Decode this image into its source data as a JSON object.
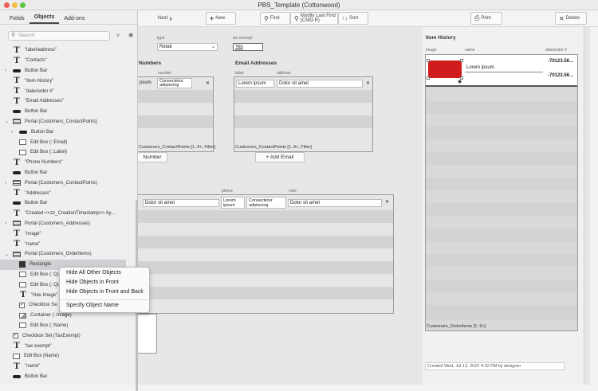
{
  "window": {
    "title": "PBS_Template (Cottonwood)"
  },
  "toolbar": {
    "next": "Next",
    "new": "New",
    "find": "Find",
    "modify_last_find": "Modify Last Find",
    "modify_shortcut": "(CMD-R)",
    "sort": "Sort",
    "print": "Print",
    "delete": "Delete"
  },
  "sidebar": {
    "tabs": [
      "Fields",
      "Objects",
      "Add-ons"
    ],
    "search_placeholder": "Search",
    "objects": [
      {
        "label": "\"label/address\"",
        "icon": "text",
        "indent": 0
      },
      {
        "label": "\"Contacts\"",
        "icon": "text",
        "indent": 0
      },
      {
        "label": "Button Bar",
        "icon": "buttonbar",
        "indent": 0,
        "arrow": true
      },
      {
        "label": "\"Item History\"",
        "icon": "text",
        "indent": 0
      },
      {
        "label": "\"date/order #\"",
        "icon": "text",
        "indent": 0
      },
      {
        "label": "\"Email Addresses\"",
        "icon": "text",
        "indent": 0
      },
      {
        "label": "Button Bar",
        "icon": "buttonbar",
        "indent": 0
      },
      {
        "label": "Portal (Customers_ContactPoints)",
        "icon": "portal",
        "indent": 0,
        "arrow": true,
        "open": true
      },
      {
        "label": "Button Bar",
        "icon": "buttonbar",
        "indent": 1,
        "arrow": true
      },
      {
        "label": "Edit Box (::Email)",
        "icon": "editbox",
        "indent": 1
      },
      {
        "label": "Edit Box (::Label)",
        "icon": "editbox",
        "indent": 1
      },
      {
        "label": "\"Phone Numbers\"",
        "icon": "text",
        "indent": 0
      },
      {
        "label": "Button Bar",
        "icon": "buttonbar",
        "indent": 0
      },
      {
        "label": "Portal (Customers_ContactPoints)",
        "icon": "portal",
        "indent": 0,
        "arrow": true
      },
      {
        "label": "\"Addresses\"",
        "icon": "text",
        "indent": 0
      },
      {
        "label": "Button Bar",
        "icon": "buttonbar",
        "indent": 0
      },
      {
        "label": "\"Created <<zz_CreationTimestamp>> by...",
        "icon": "text",
        "indent": 0
      },
      {
        "label": "Portal (Customers_Addresses)",
        "icon": "portal",
        "indent": 0,
        "arrow": true
      },
      {
        "label": "\"image\"",
        "icon": "text",
        "indent": 0
      },
      {
        "label": "\"name\"",
        "icon": "text",
        "indent": 0
      },
      {
        "label": "Portal (Customers_OrderItems)",
        "icon": "portal",
        "indent": 0,
        "arrow": true,
        "open": true
      },
      {
        "label": "Rectangle",
        "icon": "rect",
        "indent": 1,
        "selected": true
      },
      {
        "label": "Edit Box (::Qu",
        "icon": "editbox",
        "indent": 1
      },
      {
        "label": "Edit Box (::Qu",
        "icon": "editbox",
        "indent": 1
      },
      {
        "label": "\"Has Image\"",
        "icon": "text",
        "indent": 1
      },
      {
        "label": "Checkbox Se",
        "icon": "checkbox",
        "indent": 1
      },
      {
        "label": "Container (::Image)",
        "icon": "image",
        "indent": 1
      },
      {
        "label": "Edit Box (::Name)",
        "icon": "editbox",
        "indent": 1
      },
      {
        "label": "Checkbox Set (TaxExempt)",
        "icon": "checkbox",
        "indent": 0
      },
      {
        "label": "\"tax exempt\"",
        "icon": "text",
        "indent": 0
      },
      {
        "label": "Edit Box (Name)",
        "icon": "editbox",
        "indent": 0
      },
      {
        "label": "\"name\"",
        "icon": "text",
        "indent": 0
      },
      {
        "label": "Button Bar",
        "icon": "buttonbar",
        "indent": 0
      }
    ]
  },
  "context_menu": {
    "items": [
      "Hide All Other Objects",
      "Hide Objects in Front",
      "Hide Objects in Front and Back"
    ],
    "extra": "Specify Object Name"
  },
  "layout": {
    "type_label": "type",
    "type_value": "Retail",
    "tax_label": "tax exempt",
    "tax_value": "Yes",
    "phone_header": "Numbers",
    "phone_col_number": "number",
    "phone_row_a": "psum",
    "phone_row_b": "Consectetur adipiscing",
    "phone_footer": "Customers_ContactPoints [1..4+, Filter]",
    "phone_button": "Number",
    "email_header": "Email Addresses",
    "email_col_label": "label",
    "email_col_address": "address",
    "email_row_label": "Lorem ipsum",
    "email_row_address": "Dolor sit amet",
    "email_footer": "Customers_ContactPoints [1..4+, Filter]",
    "email_button": "+ Add Email",
    "addr_col_phone": "phone",
    "addr_col_note": "note",
    "addr_row_a": "Dolor sit amet",
    "addr_row_b": "Lorem ipsum",
    "addr_row_c": "Consectetur adipiscing",
    "addr_row_d": "Dolor sit amet",
    "item_history_header": "Item History",
    "ih_col_image": "image",
    "ih_col_name": "name",
    "ih_col_date": "date/order #",
    "ih_row_name": "Lorem ipsum",
    "ih_row_num1": "-70123.56...",
    "ih_row_num2": "-70123.56...",
    "ih_footer": "Customers_OrderItems [1..9+]",
    "created": "Created Wed, Jul 13, 2022 4:32 PM by designer"
  },
  "colors": {
    "accent_red": "#d01c1c"
  }
}
